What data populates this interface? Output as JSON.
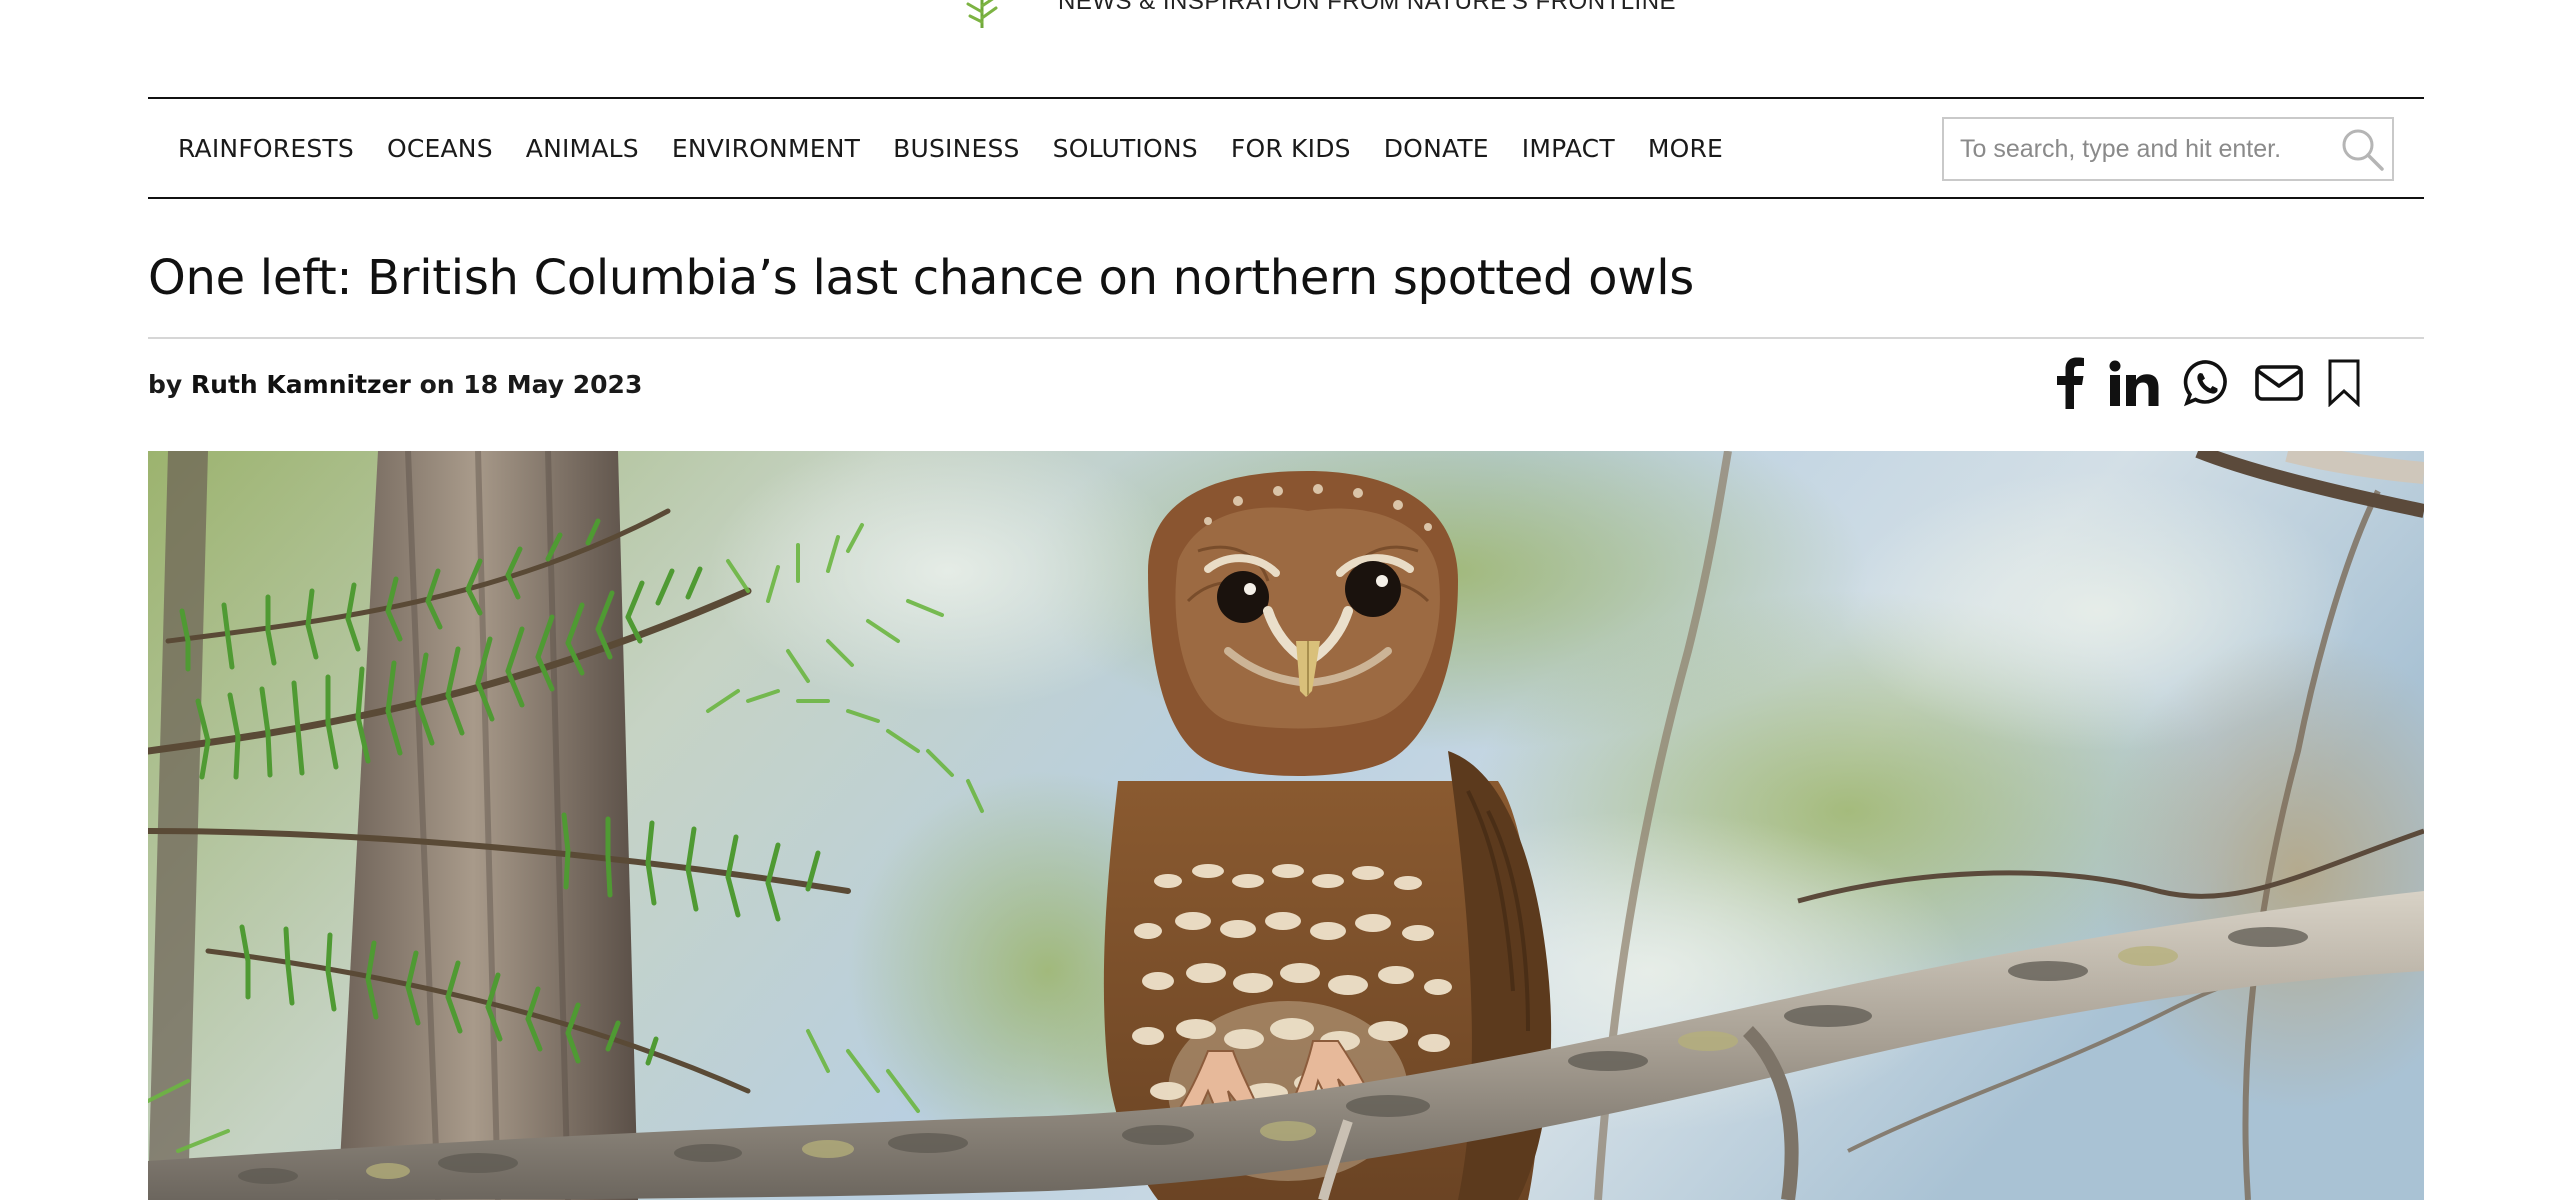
{
  "masthead": {
    "tagline": "NEWS & INSPIRATION FROM NATURE'S FRONTLINE",
    "logo_icon": "leaf-logo-icon"
  },
  "nav": {
    "items": [
      {
        "label": "RAINFORESTS"
      },
      {
        "label": "OCEANS"
      },
      {
        "label": "ANIMALS"
      },
      {
        "label": "ENVIRONMENT"
      },
      {
        "label": "BUSINESS"
      },
      {
        "label": "SOLUTIONS"
      },
      {
        "label": "FOR KIDS"
      },
      {
        "label": "DONATE"
      },
      {
        "label": "IMPACT"
      },
      {
        "label": "MORE"
      }
    ]
  },
  "search": {
    "placeholder": "To search, type and hit enter.",
    "value": "",
    "icon": "search-icon"
  },
  "article": {
    "title": "One left: British Columbia’s last chance on northern spotted owls",
    "byline_prefix": "by",
    "author": "Ruth Kamnitzer",
    "date_prefix": "on",
    "date": "18 May 2023",
    "hero_image_alt": "Northern spotted owl perched on a lichen-covered branch among conifer boughs"
  },
  "share": {
    "icons": [
      "facebook-icon",
      "linkedin-icon",
      "whatsapp-icon",
      "email-icon",
      "bookmark-icon"
    ]
  },
  "colors": {
    "text": "#111111",
    "rule": "#d6d6d6",
    "search_border": "#c9c9c9",
    "logo_green": "#7cb342"
  }
}
